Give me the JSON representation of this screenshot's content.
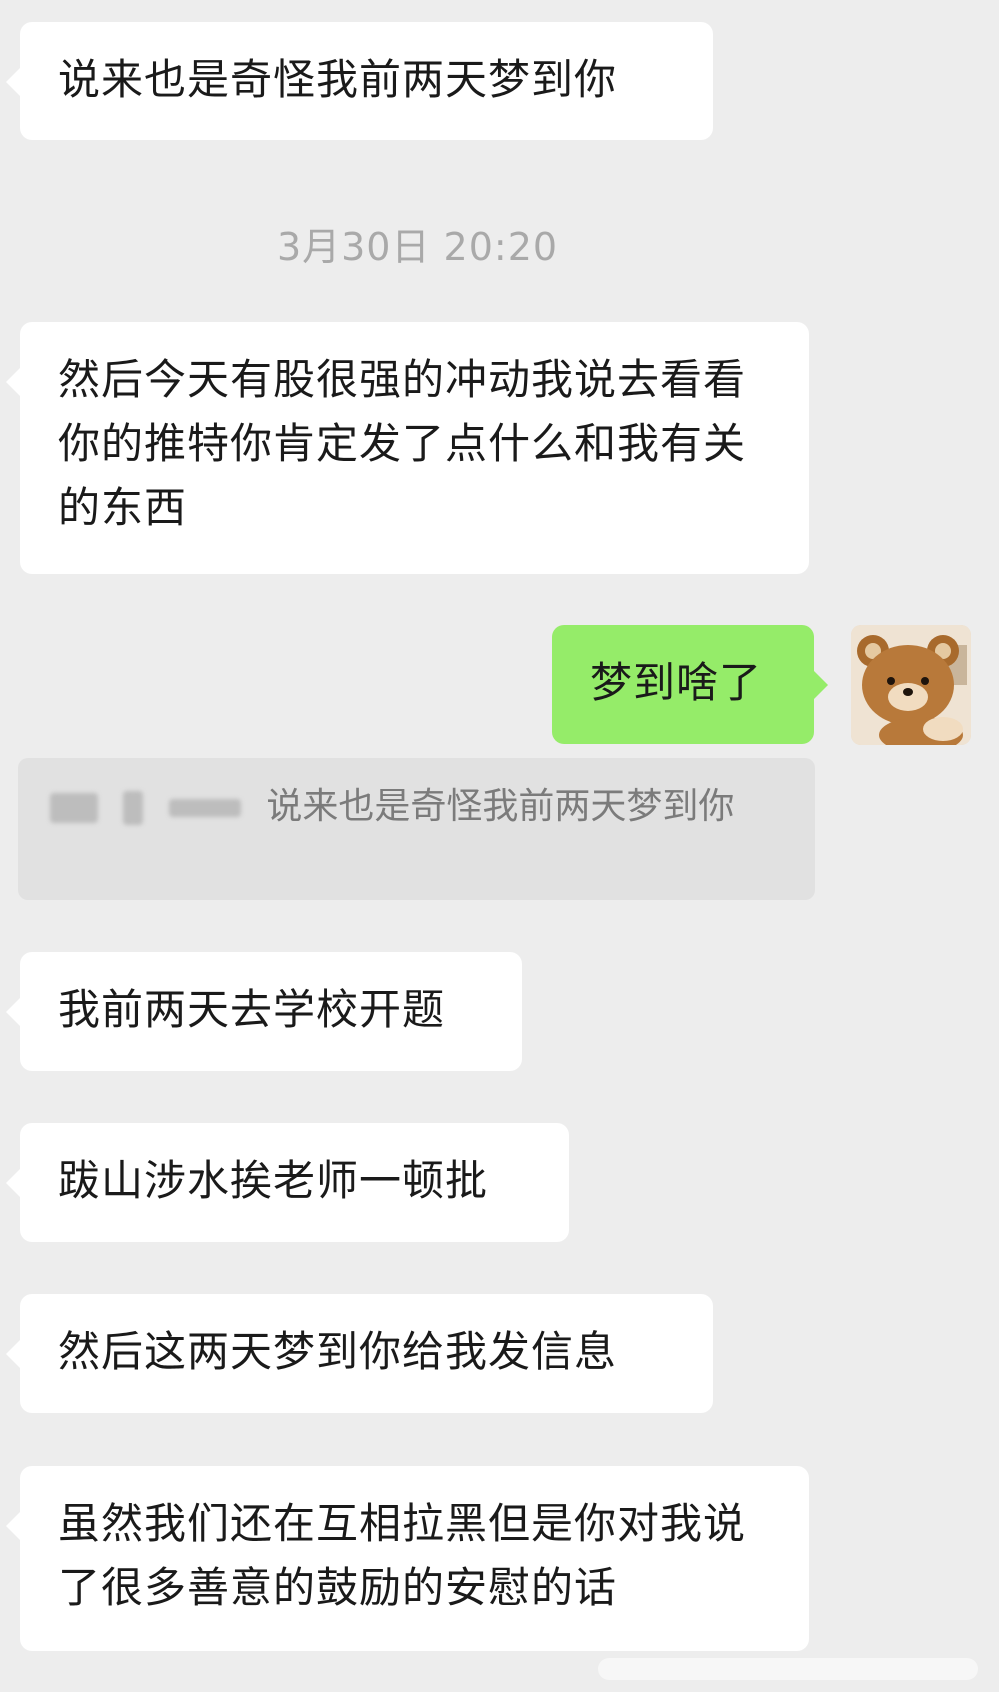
{
  "messages": [
    {
      "text": "说来也是奇怪我前两天梦到你"
    },
    {
      "text": "然后今天有股很强的冲动我说去看看你的推特你肯定发了点什么和我有关的东西"
    },
    {
      "text": "梦到啥了"
    },
    {
      "text": "我前两天去学校开题"
    },
    {
      "text": "跋山涉水挨老师一顿批"
    },
    {
      "text": "然后这两天梦到你给我发信息"
    },
    {
      "text": "虽然我们还在互相拉黑但是你对我说了很多善意的鼓励的安慰的话"
    }
  ],
  "timestamp": "3月30日 20:20",
  "quote": {
    "text": "说来也是奇怪我前两天梦到你"
  },
  "colors": {
    "background": "#ededed",
    "incoming_bubble": "#ffffff",
    "outgoing_bubble": "#95ec69",
    "quote_background": "#e1e1e1"
  },
  "icons": {
    "avatar": "bear-avatar-icon"
  }
}
